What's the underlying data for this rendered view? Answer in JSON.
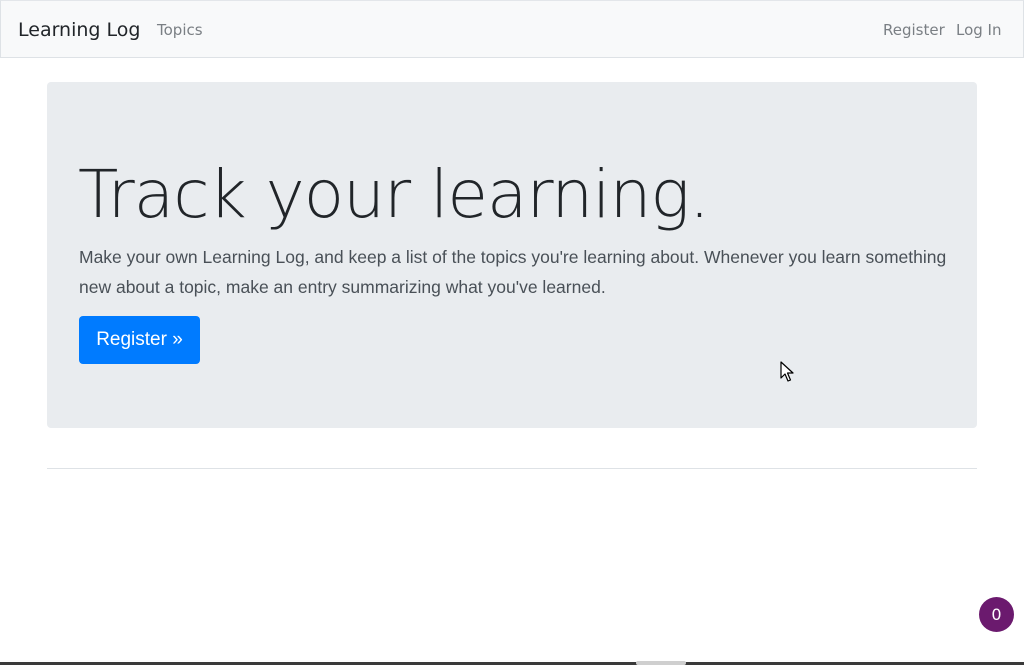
{
  "navbar": {
    "brand": "Learning Log",
    "links": {
      "topics": "Topics",
      "register": "Register",
      "login": "Log In"
    }
  },
  "hero": {
    "title": "Track your learning.",
    "lead": "Make your own Learning Log, and keep a list of the topics you're learning about. Whenever you learn something new about a topic, make an entry summarizing what you've learned.",
    "button_label": "Register »"
  },
  "widget": {
    "badge_count": "0"
  },
  "colors": {
    "primary": "#007bff",
    "jumbotron_bg": "#e9ecef",
    "navbar_bg": "#f8f9fa",
    "badge_bg": "#6b1a6e"
  },
  "icons": {
    "cursor": "mouse-pointer-icon"
  }
}
